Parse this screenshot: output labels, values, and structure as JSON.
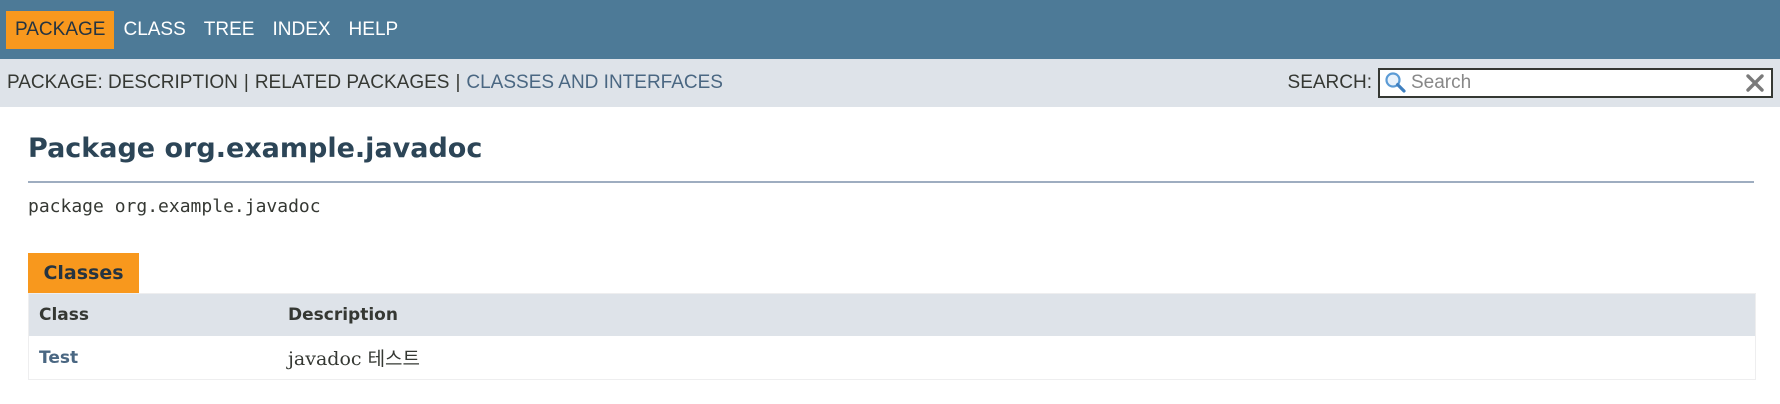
{
  "nav": {
    "items": [
      {
        "label": "PACKAGE",
        "active": true
      },
      {
        "label": "CLASS",
        "active": false
      },
      {
        "label": "TREE",
        "active": false
      },
      {
        "label": "INDEX",
        "active": false
      },
      {
        "label": "HELP",
        "active": false
      }
    ]
  },
  "subnav": {
    "prefix": "PACKAGE:",
    "description": "DESCRIPTION",
    "separator": "|",
    "related": "RELATED PACKAGES",
    "classes_link": "CLASSES AND INTERFACES"
  },
  "search": {
    "label": "SEARCH:",
    "placeholder": "Search",
    "value": ""
  },
  "page": {
    "title": "Package org.example.javadoc",
    "signature": "package org.example.javadoc"
  },
  "summary": {
    "tab_label": "Classes",
    "columns": [
      "Class",
      "Description"
    ],
    "rows": [
      {
        "class": "Test",
        "description": "javadoc 테스트"
      }
    ]
  },
  "colors": {
    "nav_bg": "#4d7a97",
    "accent": "#f8981d",
    "subnav_bg": "#dee3e9",
    "link": "#4a6782",
    "title": "#2c4557"
  }
}
